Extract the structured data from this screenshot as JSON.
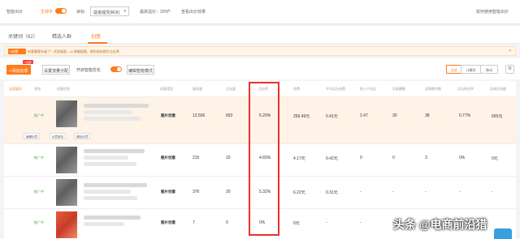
{
  "topbar": {
    "smart_bid_label": "智能出价",
    "status_label": "生效中",
    "target_label": "目标:",
    "target_select": "促进成交(ROI)",
    "max_ratio_label": "最高溢价：20%",
    "view_effect_link": "查看出价效果",
    "help_link": "如何使用智能出价"
  },
  "tabs": [
    {
      "label": "关键词（62）",
      "active": false
    },
    {
      "label": "精选人群",
      "active": false
    },
    {
      "label": "创意",
      "active": true
    }
  ],
  "notice": {
    "badge": "V创意",
    "text": "创意重要升级了！优质画面，AI 智能配图，助你轻松提升点击率",
    "close": "×"
  },
  "toolbar": {
    "add_button": "+添加创意",
    "new_tag": "V创意",
    "flow_button": "设置流量分配",
    "smart_opt_label": "开启智能优化",
    "smart_opt_on": true,
    "edit_mode_button": "编辑智能模式",
    "device_tabs": [
      "全部",
      "计算机",
      "移动"
    ],
    "device_active": 0
  },
  "table": {
    "headers": [
      "全部展开",
      "状态",
      "创意信息",
      "",
      "创意类型",
      "展现量",
      "点击量",
      "点击率",
      "花费",
      "平均点击花费",
      "投入产出比",
      "总收藏数",
      "总购物车数",
      "总成交笔数",
      "点击转化率",
      "总成交金额"
    ],
    "rows": [
      {
        "status": "推广中",
        "type": "图片创意",
        "impressions": "12,556",
        "clicks": "653",
        "ctr": "5.20%",
        "cost": "269.49元",
        "cpc": "0.41元",
        "roi": "2.47",
        "fav": "30",
        "cart": "38",
        "orders": "",
        "cvr": "0.77%",
        "gmv": "665元",
        "actions": [
          "编辑创意",
          "创意报告",
          "删除创意"
        ],
        "highlight": true,
        "thumb_style": "gray"
      },
      {
        "status": "推广中",
        "type": "图片创意",
        "impressions": "215",
        "clicks": "10",
        "ctr": "4.65%",
        "cost": "4.17元",
        "cpc": "0.42元",
        "roi": "0",
        "fav": "0",
        "cart": "3",
        "orders": "",
        "cvr": "0%",
        "gmv": "0元",
        "actions": [],
        "highlight": false,
        "thumb_style": "gray"
      },
      {
        "status": "推广中",
        "type": "图片创意",
        "impressions": "376",
        "clicks": "20",
        "ctr": "5.32%",
        "cost": "6.22元",
        "cpc": "0.31元",
        "roi": "-",
        "fav": "-",
        "cart": "-",
        "orders": "",
        "cvr": "-",
        "gmv": "-",
        "actions": [],
        "highlight": false,
        "thumb_style": "gray"
      },
      {
        "status": "推广中",
        "type": "图片创意",
        "impressions": "7",
        "clicks": "0",
        "ctr": "0%",
        "cost": "0元",
        "cpc": "-",
        "roi": "-",
        "fav": "-",
        "cart": "-",
        "orders": "",
        "cvr": "-",
        "gmv": "-",
        "actions": [],
        "highlight": false,
        "thumb_style": "red"
      }
    ]
  },
  "watermark": "头条 @电商前沿猎",
  "colors": {
    "accent": "#ff7b1c",
    "highlight_box": "#e8302a",
    "status_green": "#5aa54a"
  }
}
